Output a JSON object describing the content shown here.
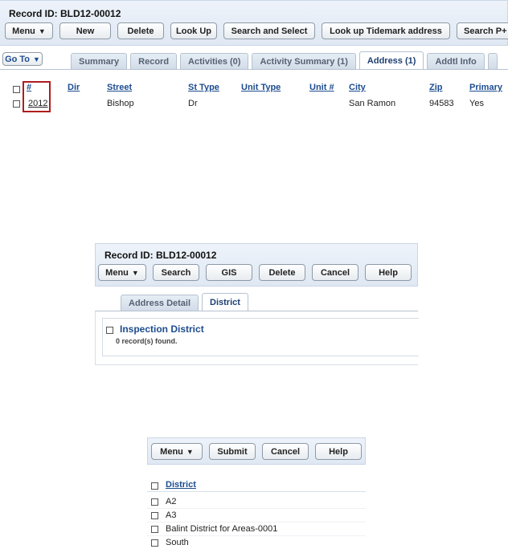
{
  "panel1": {
    "record_title": "Record ID: BLD12-00012",
    "buttons": {
      "menu": "Menu",
      "new": "New",
      "delete": "Delete",
      "look_up": "Look Up",
      "search_select": "Search and Select",
      "look_up_tidemark": "Look up Tidemark address",
      "search_p": "Search P+"
    },
    "goto": "Go To",
    "tabs": {
      "summary": "Summary",
      "record": "Record",
      "activities": "Activities (0)",
      "activity_summary": "Activity Summary (1)",
      "address": "Address (1)",
      "addtl_info": "Addtl Info"
    },
    "columns": {
      "num": "#",
      "dir": "Dir",
      "street": "Street",
      "st_type": "St Type",
      "unit_type": "Unit Type",
      "unit_num": "Unit #",
      "city": "City",
      "zip": "Zip",
      "primary": "Primary"
    },
    "row": {
      "num": "2012",
      "dir": "",
      "street": "Bishop",
      "st_type": "Dr",
      "unit_type": "",
      "unit_num": "",
      "city": "San Ramon",
      "zip": "94583",
      "primary": "Yes"
    },
    "highlight_color": "#b01c1c"
  },
  "panel2": {
    "record_title": "Record ID: BLD12-00012",
    "buttons": {
      "menu": "Menu",
      "search": "Search",
      "gis": "GIS",
      "delete": "Delete",
      "cancel": "Cancel",
      "help": "Help"
    },
    "tabs": {
      "address_detail": "Address Detail",
      "district": "District"
    },
    "section_title": "Inspection District",
    "record_count": "0 record(s) found."
  },
  "panel3": {
    "buttons": {
      "menu": "Menu",
      "submit": "Submit",
      "cancel": "Cancel",
      "help": "Help"
    },
    "column": "District",
    "items": [
      "A2",
      "A3",
      "Balint District for Areas-0001",
      "South"
    ]
  }
}
